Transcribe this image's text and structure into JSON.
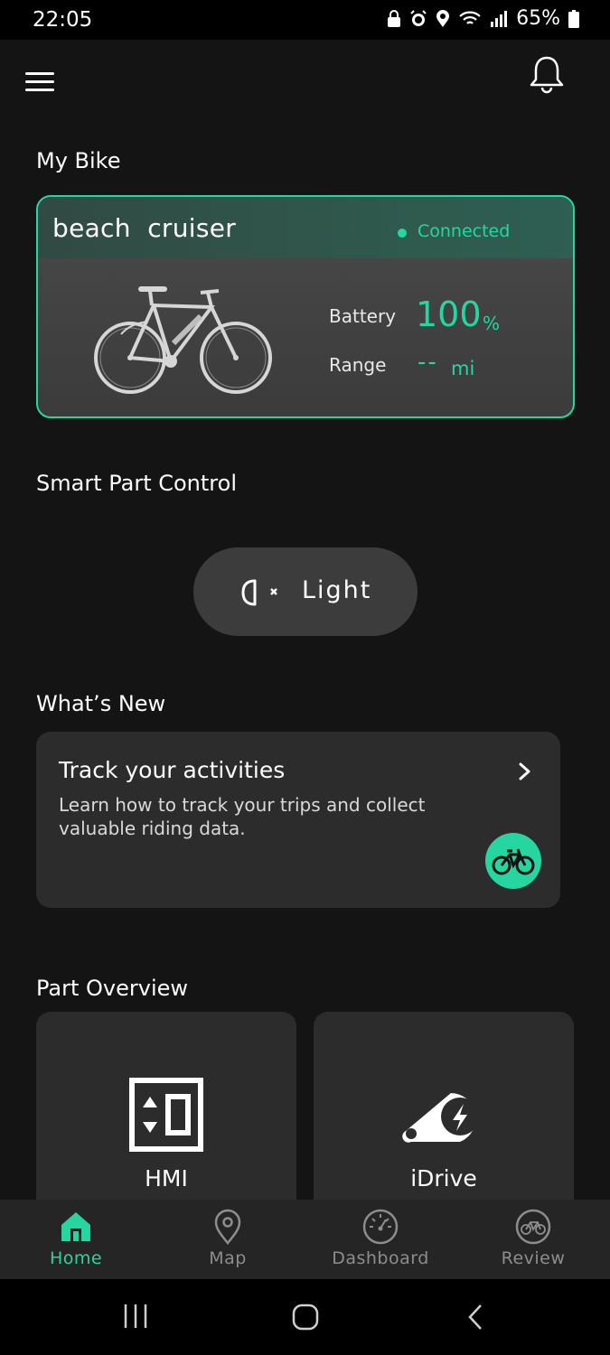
{
  "status_bar": {
    "time": "22:05",
    "battery_percent": "65%",
    "icons": [
      "lock-icon",
      "alarm-icon",
      "location-icon",
      "wifi-icon",
      "signal-icon",
      "battery-icon"
    ]
  },
  "header": {
    "menu_icon": "hamburger-menu-icon",
    "notification_icon": "bell-icon"
  },
  "my_bike": {
    "section_title": "My Bike",
    "bike_name": "beach  cruiser",
    "connection_status": "Connected",
    "battery_label": "Battery",
    "battery_value": "100",
    "battery_unit": "%",
    "range_label": "Range",
    "range_value": "--",
    "range_unit": "mi"
  },
  "smart_part_control": {
    "section_title": "Smart Part Control",
    "light_label": "Light",
    "light_icon": "headlight-off-icon"
  },
  "whats_new": {
    "section_title": "What’s New",
    "card_title": "Track your activities",
    "card_description": "Learn how to track your trips and collect valuable riding data.",
    "badge_icon": "bicycle-icon"
  },
  "part_overview": {
    "section_title": "Part Overview",
    "parts": [
      {
        "label": "HMI",
        "icon": "hmi-display-icon"
      },
      {
        "label": "iDrive",
        "icon": "drive-motor-icon"
      }
    ]
  },
  "bottom_nav": {
    "items": [
      {
        "label": "Home",
        "icon": "home-icon",
        "active": true
      },
      {
        "label": "Map",
        "icon": "map-pin-icon",
        "active": false
      },
      {
        "label": "Dashboard",
        "icon": "speedometer-icon",
        "active": false
      },
      {
        "label": "Review",
        "icon": "bicycle-icon",
        "active": false
      }
    ]
  },
  "colors": {
    "accent": "#26d6a0",
    "background": "#141414",
    "card": "#2c2c2c"
  }
}
